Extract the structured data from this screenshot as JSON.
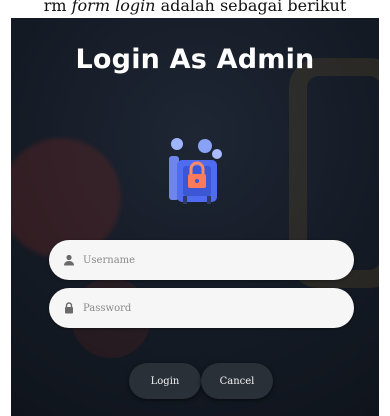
{
  "caption": {
    "prefix": "rm ",
    "emphasis": "form login",
    "suffix": " adalah sebagai berikut"
  },
  "login": {
    "title": "Login As Admin",
    "illustration_icon": "padlock-security-illustration",
    "username": {
      "placeholder": "Username",
      "icon": "user-icon"
    },
    "password": {
      "placeholder": "Password",
      "icon": "lock-icon"
    },
    "buttons": {
      "login": "Login",
      "cancel": "Cancel"
    }
  },
  "colors": {
    "background": "#141a24",
    "field": "#f6f6f6",
    "button": "#2a3038",
    "title": "#ffffff"
  }
}
